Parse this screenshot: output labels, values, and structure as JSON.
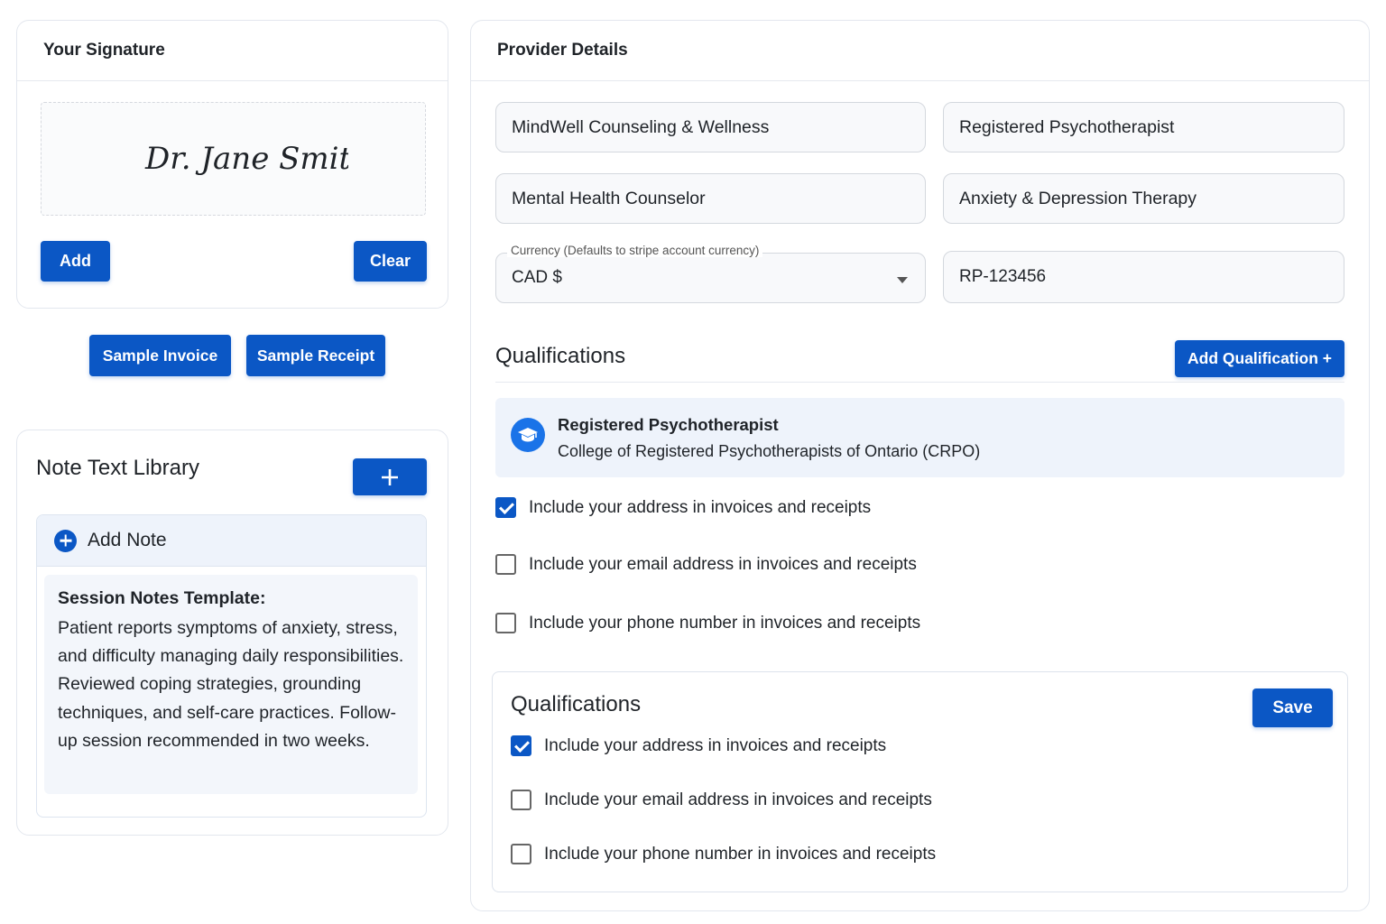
{
  "signature": {
    "title": "Your Signature",
    "signature_text": "Dr. Jane Smith",
    "add_label": "Add",
    "clear_label": "Clear"
  },
  "samples": {
    "invoice_label": "Sample Invoice",
    "receipt_label": "Sample Receipt"
  },
  "note_library": {
    "title": "Note Text Library",
    "add_button_icon": "plus-icon",
    "add_note_label": "Add Note",
    "template_title": "Session Notes Template:",
    "template_body": "Patient reports symptoms of anxiety, stress, and difficulty managing daily responsibilities. Reviewed coping strategies, grounding techniques, and self-care practices. Follow-up session recommended in two weeks."
  },
  "provider": {
    "title": "Provider Details",
    "practice_name": "MindWell Counseling & Wellness",
    "designation": "Registered Psychotherapist",
    "role": "Mental Health Counselor",
    "specialty": "Anxiety & Depression Therapy",
    "currency_label": "Currency (Defaults to stripe account currency)",
    "currency_value": "CAD $",
    "registration_number": "RP-123456"
  },
  "qualifications": {
    "title": "Qualifications",
    "add_label": "Add Qualification +",
    "items": [
      {
        "icon": "graduation-cap-icon",
        "title": "Registered Psychotherapist",
        "subtitle": "College of Registered Psychotherapists of Ontario (CRPO)"
      }
    ],
    "options": [
      {
        "label": "Include your address in invoices and receipts",
        "checked": true
      },
      {
        "label": "Include your email address in invoices and receipts",
        "checked": false
      },
      {
        "label": "Include your phone number in invoices and receipts",
        "checked": false
      }
    ]
  },
  "qualifications_box": {
    "title": "Qualifications",
    "save_label": "Save",
    "options": [
      {
        "label": "Include your address in invoices and receipts",
        "checked": true
      },
      {
        "label": "Include your email address in invoices and receipts",
        "checked": false
      },
      {
        "label": "Include your phone number in invoices and receipts",
        "checked": false
      }
    ]
  },
  "colors": {
    "accent": "#0b57c5",
    "panel_tint": "#eef3fb",
    "border": "#e3e7ee"
  }
}
